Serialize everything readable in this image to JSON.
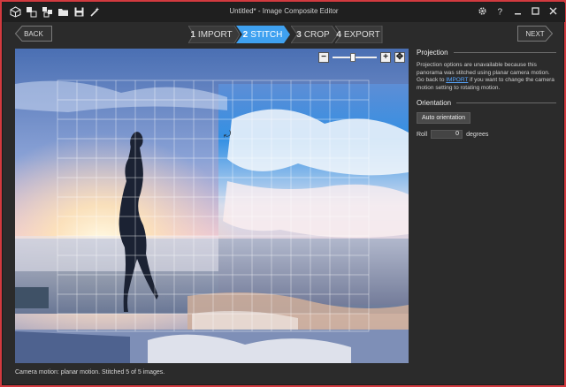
{
  "window": {
    "title": "Untitled* - Image Composite Editor"
  },
  "toolbar": {
    "icons": [
      "cube-icon",
      "new-stitch-icon",
      "new-panorama-icon",
      "open-folder-icon",
      "save-icon",
      "wand-icon"
    ]
  },
  "nav": {
    "back_label": "BACK",
    "next_label": "NEXT",
    "steps": [
      {
        "number": "1",
        "name": "IMPORT",
        "active": false
      },
      {
        "number": "2",
        "name": "STITCH",
        "active": true
      },
      {
        "number": "3",
        "name": "CROP",
        "active": false
      },
      {
        "number": "4",
        "name": "EXPORT",
        "active": false
      }
    ]
  },
  "zoom": {
    "level": 0.45
  },
  "panel": {
    "projection_title": "Projection",
    "projection_text_a": "Projection options are unavailable because this panorama was stitched using planar camera motion. Go back to ",
    "projection_link": "IMPORT",
    "projection_text_b": " if you want to change the camera motion setting to rotating motion.",
    "orientation_title": "Orientation",
    "auto_orientation_label": "Auto orientation",
    "roll_label": "Roll",
    "roll_value": "0",
    "roll_unit": "degrees"
  },
  "status": "Camera motion: planar motion. Stitched 5 of 5 images.",
  "colors": {
    "accent": "#3fa1f0",
    "background": "#2b2b2b",
    "frame": "#d23a3f"
  }
}
